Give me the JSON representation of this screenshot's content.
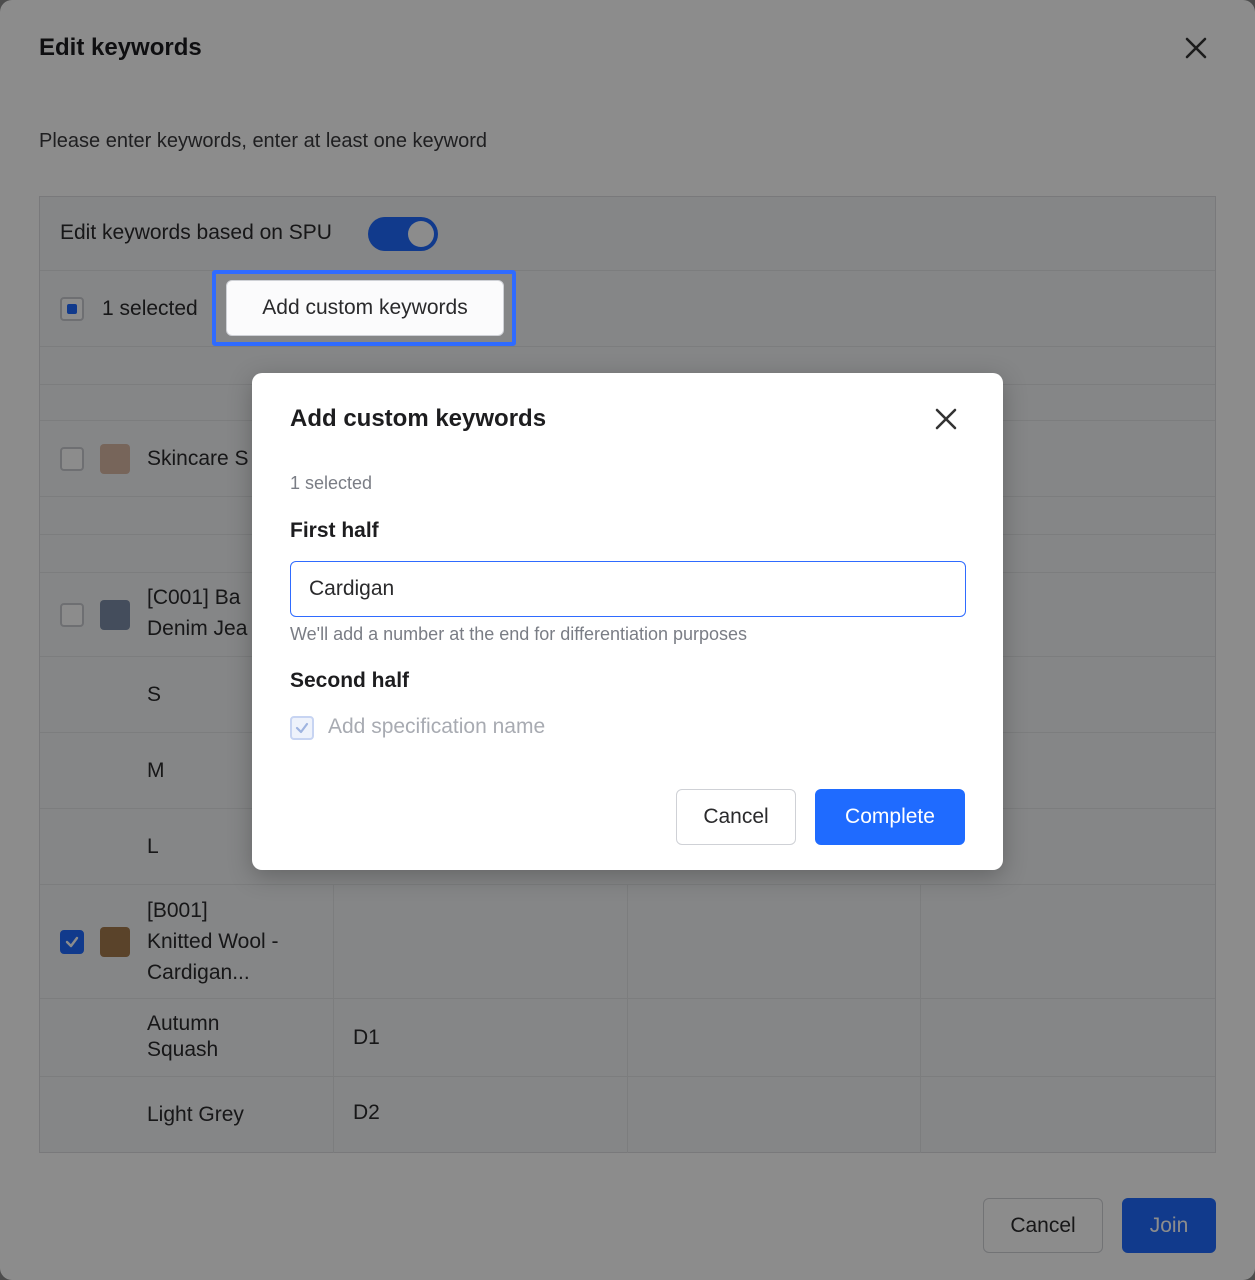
{
  "outer": {
    "title": "Edit keywords",
    "description": "Please enter keywords, enter at least one keyword",
    "spu_toggle_label": "Edit keywords based on SPU",
    "spu_toggle_on": true,
    "selected_text": "1 selected",
    "add_custom_label": "Add custom keywords",
    "cancel_label": "Cancel",
    "join_label": "Join",
    "rows": {
      "skincare": "Skincare S",
      "denim_line1": "[C001] Ba",
      "denim_line2": "Denim Jea",
      "size_s": "S",
      "size_m": "M",
      "size_l": "L",
      "wool_line1": "[B001]",
      "wool_line2": "Knitted Wool -",
      "wool_line3": "Cardigan...",
      "autumn_line1": "Autumn",
      "autumn_line2": "Squash",
      "autumn_value": "D1",
      "grey": "Light Grey",
      "grey_value": "D2"
    }
  },
  "dialog": {
    "title": "Add custom keywords",
    "selected_text": "1 selected",
    "first_half_label": "First half",
    "first_half_value": "Cardigan",
    "hint": "We'll add a number at the end for differentiation purposes",
    "second_half_label": "Second half",
    "add_spec_label": "Add specification name",
    "add_spec_checked": true,
    "cancel_label": "Cancel",
    "complete_label": "Complete"
  },
  "colors": {
    "accent": "#1f6bff",
    "highlight_border": "#2f6bff"
  }
}
